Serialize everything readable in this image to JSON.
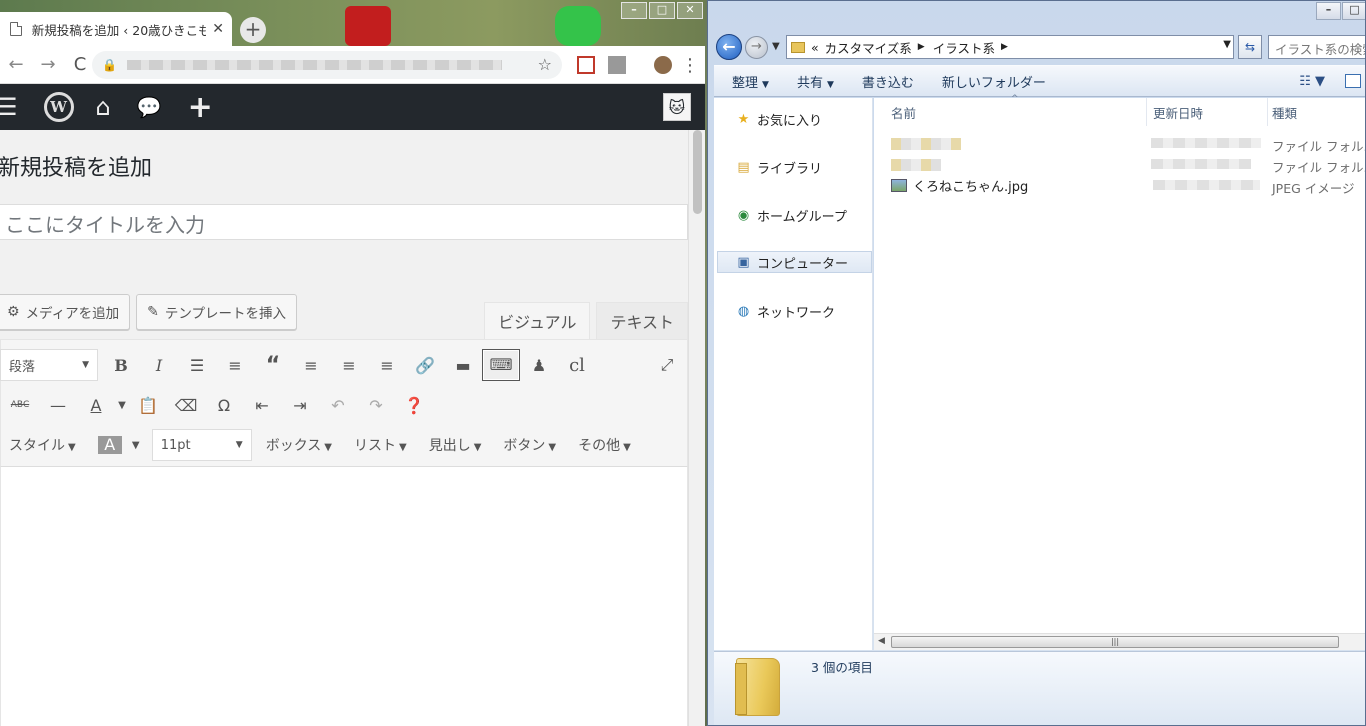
{
  "browser": {
    "tab_title": "新規投稿を追加 ‹ 20歳ひきこも",
    "tab_close": "✕",
    "new_tab": "+",
    "back": "←",
    "forward": "→",
    "reload": "C",
    "star": "☆",
    "menu": "⋮"
  },
  "wp": {
    "admin_bar": {
      "menu_icon": "☰",
      "wp_logo": "W",
      "home_icon": "⌂",
      "comment_icon": "💬",
      "new_icon": "+"
    },
    "page_title": "新規投稿を追加",
    "title_placeholder": "ここにタイトルを入力",
    "add_media": "メディアを追加",
    "insert_template": "テンプレートを挿入",
    "tab_visual": "ビジュアル",
    "tab_text": "テキスト",
    "format_select": "段落",
    "font_size": "11pt",
    "cl_label": "cl",
    "dropdowns": [
      "スタイル",
      "ボックス",
      "リスト",
      "見出し",
      "ボタン",
      "その他"
    ]
  },
  "explorer": {
    "breadcrumbs": [
      "«",
      "カスタマイズ系",
      "イラスト系"
    ],
    "search_placeholder": "イラスト系の検索",
    "commands": [
      "整理",
      "共有",
      "書き込む",
      "新しいフォルダー"
    ],
    "nav": [
      "お気に入り",
      "ライブラリ",
      "ホームグループ",
      "コンピューター",
      "ネットワーク"
    ],
    "columns": [
      "名前",
      "更新日時",
      "種類"
    ],
    "files": [
      {
        "name": "",
        "type": "ファイル フォル..."
      },
      {
        "name": "",
        "type": "ファイル フォル..."
      },
      {
        "name": "くろねこちゃん.jpg",
        "type": "JPEG イメージ"
      }
    ],
    "item_count": "3 個の項目"
  }
}
